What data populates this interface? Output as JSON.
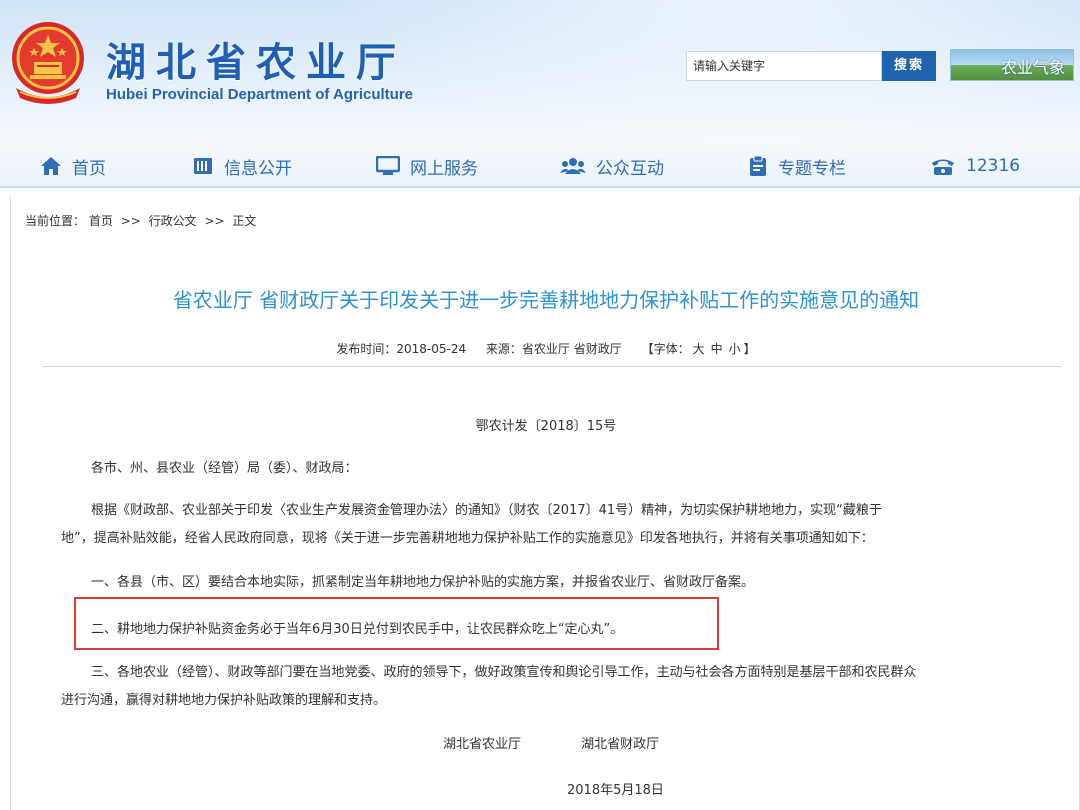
{
  "header": {
    "title_cn": "湖北省农业厅",
    "title_en": "Hubei Provincial Department of Agriculture",
    "search": {
      "value": "请输入关键字",
      "button_label": "搜索"
    },
    "weather_banner_label": "农业气象"
  },
  "nav": {
    "items": [
      {
        "label": "首页",
        "icon": "home-icon"
      },
      {
        "label": "信息公开",
        "icon": "document-icon"
      },
      {
        "label": "网上服务",
        "icon": "monitor-icon"
      },
      {
        "label": "公众互动",
        "icon": "users-icon"
      },
      {
        "label": "专题专栏",
        "icon": "clipboard-icon"
      },
      {
        "label": "12316",
        "icon": "phone-icon"
      }
    ]
  },
  "breadcrumb": {
    "prefix": "当前位置：",
    "items": [
      "首页",
      "行政公文",
      "正文"
    ],
    "separator": ">>"
  },
  "article": {
    "title": "省农业厅 省财政厅关于印发关于进一步完善耕地地力保护补贴工作的实施意见的通知",
    "meta": {
      "publish_label": "发布时间：2018-05-24",
      "source_label": "来源：省农业厅 省财政厅",
      "font_size_prefix": "【字体：",
      "font_sizes": [
        "大",
        "中",
        "小"
      ],
      "font_size_suffix": "】"
    },
    "doc_number": "鄂农计发〔2018〕15号",
    "salutation": "各市、州、县农业（经管）局（委）、财政局：",
    "paragraph_1a": "根据《财政部、农业部关于印发〈农业生产发展资金管理办法〉的通知》（财农〔2017〕41号）精神，为切实保护耕地地力，实现“藏粮于",
    "paragraph_1b": "地”，提高补贴效能，经省人民政府同意，现将《关于进一步完善耕地地力保护补贴工作的实施意见》印发各地执行，并将有关事项通知如下：",
    "item_1": "一、各县（市、区）要结合本地实际，抓紧制定当年耕地地力保护补贴的实施方案，并报省农业厅、省财政厅备案。",
    "item_2": "二、耕地地力保护补贴资金务必于当年6月30日兑付到农民手中，让农民群众吃上“定心丸”。",
    "item_3a": "三、各地农业（经管）、财政等部门要在当地党委、政府的领导下，做好政策宣传和舆论引导工作，主动与社会各方面特别是基层干部和农民群众",
    "item_3b": "进行沟通，赢得对耕地地力保护补贴政策的理解和支持。",
    "signatories": [
      "湖北省农业厅",
      "湖北省财政厅"
    ],
    "date": "2018年5月18日"
  },
  "colors": {
    "brand_blue": "#1f5fb6",
    "title_blue": "#2e93d6",
    "highlight_red": "#e2393a"
  }
}
